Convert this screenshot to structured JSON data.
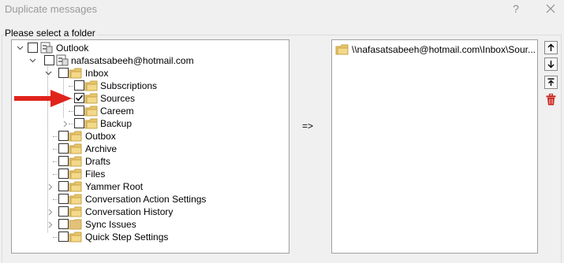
{
  "window": {
    "title": "Duplicate messages",
    "help_label": "?"
  },
  "group_label": "Please select a folder",
  "tree": {
    "root": {
      "label": "Outlook",
      "checked": false,
      "expanded": true
    },
    "account": {
      "label": "nafasatsabeeh@hotmail.com",
      "checked": false,
      "expanded": true
    },
    "inbox": {
      "label": "Inbox",
      "checked": false,
      "expanded": true
    },
    "inbox_children": [
      {
        "label": "Subscriptions",
        "checked": false
      },
      {
        "label": "Sources",
        "checked": true
      },
      {
        "label": "Careem",
        "checked": false
      },
      {
        "label": "Backup",
        "checked": false,
        "expandable": true
      }
    ],
    "account_children": [
      {
        "label": "Outbox",
        "checked": false
      },
      {
        "label": "Archive",
        "checked": false
      },
      {
        "label": "Drafts",
        "checked": false
      },
      {
        "label": "Files",
        "checked": false
      },
      {
        "label": "Yammer Root",
        "checked": false,
        "expandable": true
      },
      {
        "label": "Conversation Action Settings",
        "checked": false
      },
      {
        "label": "Conversation History",
        "checked": false,
        "expandable": true
      },
      {
        "label": "Sync Issues",
        "checked": false,
        "expandable": true
      },
      {
        "label": "Quick Step Settings",
        "checked": false
      }
    ]
  },
  "transfer_label": "=>",
  "selected_folders": [
    {
      "label": "\\\\nafasatsabeeh@hotmail.com\\Inbox\\Sour..."
    }
  ],
  "side_buttons": [
    "arrow-up-icon",
    "arrow-down-icon",
    "move-top-icon",
    "trash-icon"
  ],
  "colors": {
    "folder": "#e8c66b",
    "annotation_arrow": "#e0241c",
    "delete": "#c8201a"
  }
}
